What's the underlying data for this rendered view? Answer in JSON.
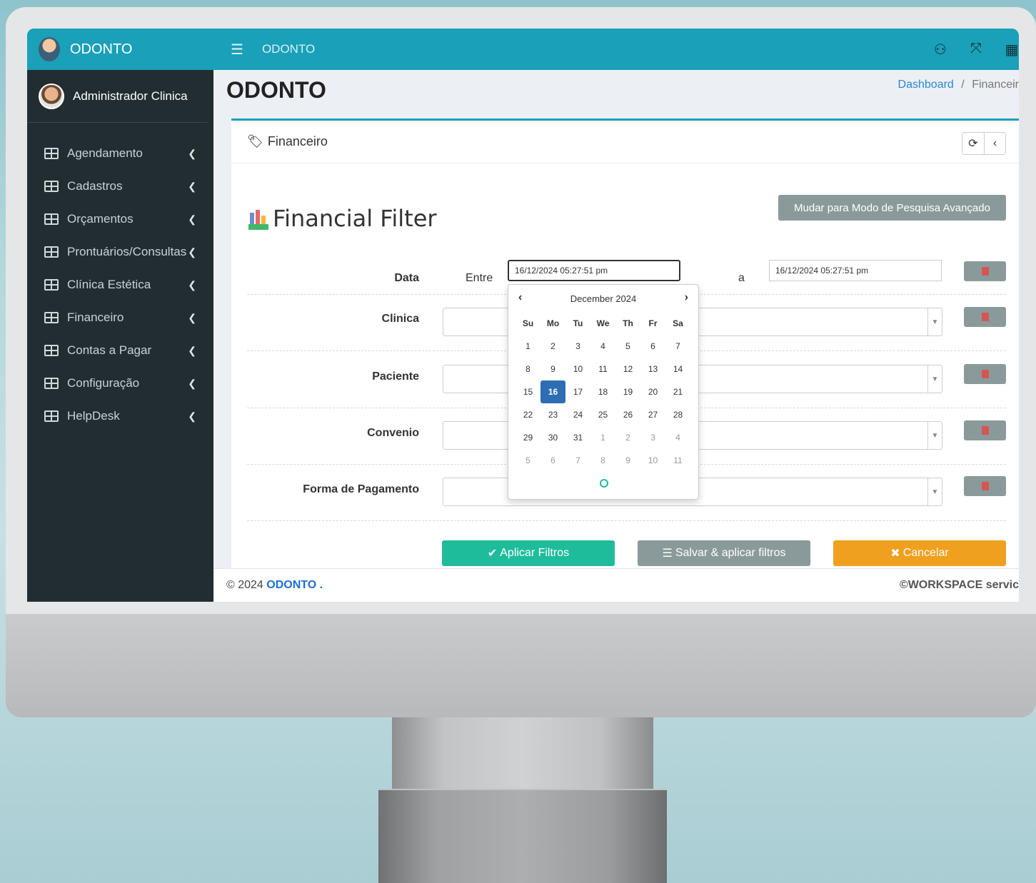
{
  "brand": {
    "name": "ODONTO"
  },
  "user": {
    "name": "Administrador Clinica"
  },
  "menu": [
    {
      "label": "Agendamento"
    },
    {
      "label": "Cadastros"
    },
    {
      "label": "Orçamentos"
    },
    {
      "label": "Prontuários/Consultas"
    },
    {
      "label": "Clínica Estética"
    },
    {
      "label": "Financeiro"
    },
    {
      "label": "Contas a Pagar"
    },
    {
      "label": "Configuração"
    },
    {
      "label": "HelpDesk"
    }
  ],
  "topbar": {
    "title": "ODONTO"
  },
  "header": {
    "title": "ODONTO",
    "breadcrumb_link": "Dashboard",
    "breadcrumb_sep": "/",
    "breadcrumb_current": "Financeir"
  },
  "box": {
    "title": "Financeiro"
  },
  "filter": {
    "title": "Financial Filter",
    "advanced_button": "Mudar para Modo de Pesquisa Avançado",
    "date_label": "Data",
    "between_label": "Entre",
    "to_label": "a",
    "date_from": "16/12/2024 05:27:51 pm",
    "date_to": "16/12/2024 05:27:51 pm",
    "clinic_label": "Clinica",
    "patient_label": "Paciente",
    "insurance_label": "Convenio",
    "payment_label": "Forma de Pagamento"
  },
  "buttons": {
    "apply": "Aplicar Filtros",
    "save_apply": "Salvar & aplicar filtros",
    "cancel": "Cancelar"
  },
  "datepicker": {
    "month_label": "December 2024",
    "weekdays": [
      "Su",
      "Mo",
      "Tu",
      "We",
      "Th",
      "Fr",
      "Sa"
    ],
    "selected_day": "16",
    "weeks": [
      [
        "1",
        "2",
        "3",
        "4",
        "5",
        "6",
        "7"
      ],
      [
        "8",
        "9",
        "10",
        "11",
        "12",
        "13",
        "14"
      ],
      [
        "15",
        "16",
        "17",
        "18",
        "19",
        "20",
        "21"
      ],
      [
        "22",
        "23",
        "24",
        "25",
        "26",
        "27",
        "28"
      ],
      [
        "29",
        "30",
        "31",
        "1",
        "2",
        "3",
        "4"
      ],
      [
        "5",
        "6",
        "7",
        "8",
        "9",
        "10",
        "11"
      ]
    ]
  },
  "footer": {
    "copyright": "© 2024",
    "brand": "ODONTO",
    "dot": ".",
    "right": "©WORKSPACE servic"
  }
}
